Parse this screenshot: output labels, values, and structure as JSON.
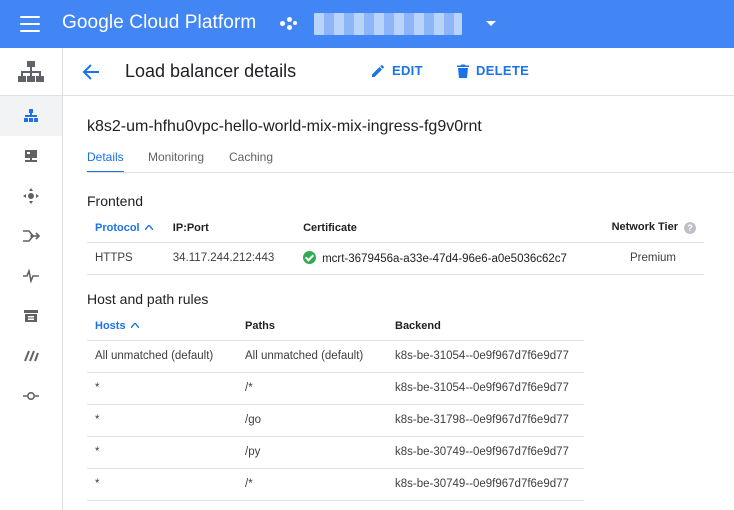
{
  "topbar": {
    "brand": "Google Cloud Platform"
  },
  "header": {
    "title": "Load balancer details",
    "edit_label": "EDIT",
    "delete_label": "DELETE"
  },
  "lb": {
    "name": "k8s2-um-hfhu0vpc-hello-world-mix-mix-ingress-fg9v0rnt"
  },
  "tabs": [
    {
      "label": "Details",
      "active": true
    },
    {
      "label": "Monitoring"
    },
    {
      "label": "Caching"
    }
  ],
  "frontend": {
    "title": "Frontend",
    "headers": {
      "protocol": "Protocol",
      "ipport": "IP:Port",
      "certificate": "Certificate",
      "tier": "Network Tier"
    },
    "rows": [
      {
        "protocol": "HTTPS",
        "ipport": "34.117.244.212:443",
        "certificate": "mcrt-3679456a-a33e-47d4-96e6-a0e5036c62c7",
        "tier": "Premium"
      }
    ]
  },
  "rules": {
    "title": "Host and path rules",
    "headers": {
      "hosts": "Hosts",
      "paths": "Paths",
      "backend": "Backend"
    },
    "rows": [
      {
        "hosts": "All unmatched (default)",
        "paths": "All unmatched (default)",
        "backend": "k8s-be-31054--0e9f967d7f6e9d77"
      },
      {
        "hosts": "*",
        "paths": "/*",
        "backend": "k8s-be-31054--0e9f967d7f6e9d77"
      },
      {
        "hosts": "*",
        "paths": "/go",
        "backend": "k8s-be-31798--0e9f967d7f6e9d77"
      },
      {
        "hosts": "*",
        "paths": "/py",
        "backend": "k8s-be-30749--0e9f967d7f6e9d77"
      },
      {
        "hosts": "*",
        "paths": "/*",
        "backend": "k8s-be-30749--0e9f967d7f6e9d77"
      }
    ]
  },
  "colors": {
    "topbar": "#4285f4",
    "accent": "#1a73e8",
    "success": "#34a853"
  }
}
